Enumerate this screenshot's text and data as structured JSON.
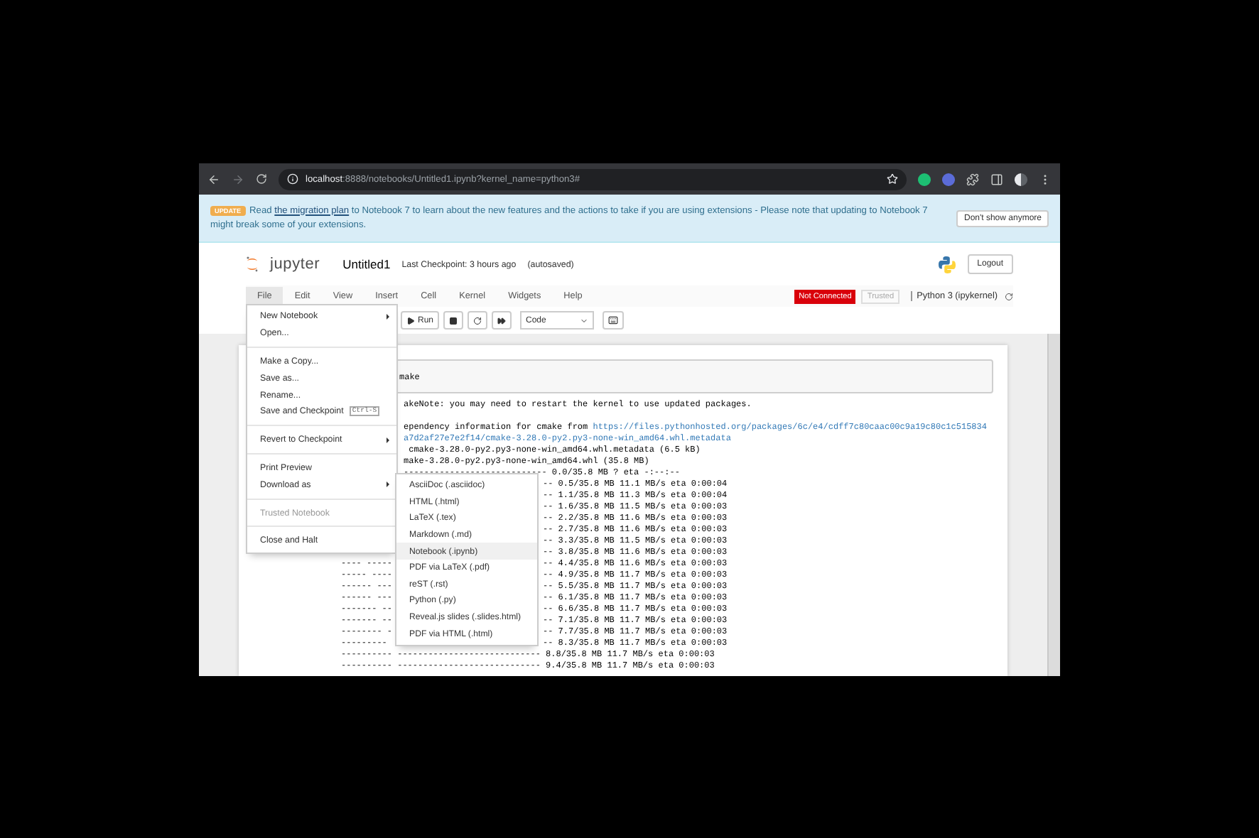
{
  "browser": {
    "url_host": "localhost",
    "url_path": ":8888/notebooks/Untitled1.ipynb?kernel_name=python3#"
  },
  "banner": {
    "badge": "UPDATE",
    "before": "Read ",
    "link": "the migration plan",
    "after": " to Notebook 7 to learn about the new features and the actions to take if you are using extensions - Please note that updating to Notebook 7 might break some of your extensions.",
    "button": "Don't show anymore"
  },
  "header": {
    "logo_text": "jupyter",
    "title": "Untitled1",
    "checkpoint": "Last Checkpoint: 3 hours ago",
    "autosave": "(autosaved)",
    "logout": "Logout"
  },
  "menubar": {
    "items": [
      {
        "label": "File",
        "selected": true
      },
      {
        "label": "Edit",
        "selected": false
      },
      {
        "label": "View",
        "selected": false
      },
      {
        "label": "Insert",
        "selected": false
      },
      {
        "label": "Cell",
        "selected": false
      },
      {
        "label": "Kernel",
        "selected": false
      },
      {
        "label": "Widgets",
        "selected": false
      },
      {
        "label": "Help",
        "selected": false
      }
    ],
    "kernel_status": "Not Connected",
    "trusted": "Trusted",
    "kernel_name": "Python 3 (ipykernel)"
  },
  "toolbar": {
    "run": "Run",
    "cell_type": "Code"
  },
  "cell": {
    "input": "make"
  },
  "output": [
    {
      "kind": "note",
      "middle": "akeNote: you may need to restart the kernel to use updated packages."
    },
    {
      "kind": "log",
      "middle": "ependency information for cmake from ",
      "link": "https://files.pythonhosted.org/packages/6c/e4/cdff7c80caac00c9a19c80c1c515834"
    },
    {
      "kind": "log",
      "link": "a7d2af27e7e2f14/cmake-3.28.0-py2.py3-none-win_amd64.whl.metadata"
    },
    {
      "kind": "log",
      "middle": " cmake-3.28.0-py2.py3-none-win_amd64.whl.metadata (6.5 kB)"
    },
    {
      "kind": "log",
      "middle": "make-3.28.0-py2.py3-none-win_amd64.whl (35.8 MB)"
    },
    {
      "kind": "log",
      "middle": "---------------------------- 0.0/35.8 MB ? eta -:--:--"
    },
    {
      "kind": "log",
      "right": "-- 0.5/35.8 MB 11.1 MB/s eta 0:00:04"
    },
    {
      "kind": "log",
      "right": "-- 1.1/35.8 MB 11.3 MB/s eta 0:00:04"
    },
    {
      "kind": "log",
      "right": "-- 1.6/35.8 MB 11.5 MB/s eta 0:00:03"
    },
    {
      "kind": "log",
      "right": "-- 2.2/35.8 MB 11.6 MB/s eta 0:00:03"
    },
    {
      "kind": "log",
      "right": "-- 2.7/35.8 MB 11.6 MB/s eta 0:00:03"
    },
    {
      "kind": "log",
      "right": "-- 3.3/35.8 MB 11.5 MB/s eta 0:00:03"
    },
    {
      "kind": "log",
      "right": "-- 3.8/35.8 MB 11.6 MB/s eta 0:00:03"
    },
    {
      "kind": "log",
      "left": "---- -----",
      "right": "-- 4.4/35.8 MB 11.6 MB/s eta 0:00:03"
    },
    {
      "kind": "log",
      "left": "----- ----",
      "right": "-- 4.9/35.8 MB 11.7 MB/s eta 0:00:03"
    },
    {
      "kind": "log",
      "left": "------ ---",
      "right": "-- 5.5/35.8 MB 11.7 MB/s eta 0:00:03"
    },
    {
      "kind": "log",
      "left": "------ ---",
      "right": "-- 6.1/35.8 MB 11.7 MB/s eta 0:00:03"
    },
    {
      "kind": "log",
      "left": "------- --",
      "right": "-- 6.6/35.8 MB 11.7 MB/s eta 0:00:03"
    },
    {
      "kind": "log",
      "left": "------- --",
      "right": "-- 7.1/35.8 MB 11.7 MB/s eta 0:00:03"
    },
    {
      "kind": "log",
      "left": "-------- -",
      "right": "-- 7.7/35.8 MB 11.7 MB/s eta 0:00:03"
    },
    {
      "kind": "log",
      "left": "---------",
      "right": "-- 8.3/35.8 MB 11.7 MB/s eta 0:00:03"
    },
    {
      "kind": "log",
      "full": "---------- ---------------------------- 8.8/35.8 MB 11.7 MB/s eta 0:00:03"
    },
    {
      "kind": "log",
      "full": "---------- ---------------------------- 9.4/35.8 MB 11.7 MB/s eta 0:00:03"
    }
  ],
  "file_menu": [
    {
      "kind": "item",
      "label": "New Notebook",
      "submenu": true,
      "disabled": false
    },
    {
      "kind": "item",
      "label": "Open...",
      "submenu": false,
      "disabled": false
    },
    {
      "kind": "divider"
    },
    {
      "kind": "item",
      "label": "Make a Copy...",
      "submenu": false,
      "disabled": false
    },
    {
      "kind": "item",
      "label": "Save as...",
      "submenu": false,
      "disabled": false
    },
    {
      "kind": "item",
      "label": "Rename...",
      "submenu": false,
      "disabled": false
    },
    {
      "kind": "item",
      "label": "Save and Checkpoint",
      "shortcut": "Ctrl-S",
      "submenu": false,
      "disabled": false
    },
    {
      "kind": "divider"
    },
    {
      "kind": "item",
      "label": "Revert to Checkpoint",
      "submenu": true,
      "disabled": false
    },
    {
      "kind": "divider"
    },
    {
      "kind": "item",
      "label": "Print Preview",
      "submenu": false,
      "disabled": false
    },
    {
      "kind": "item",
      "label": "Download as",
      "submenu": true,
      "disabled": false
    },
    {
      "kind": "divider"
    },
    {
      "kind": "item",
      "label": "Trusted Notebook",
      "submenu": false,
      "disabled": true
    },
    {
      "kind": "divider"
    },
    {
      "kind": "item",
      "label": "Close and Halt",
      "submenu": false,
      "disabled": false
    }
  ],
  "download_menu": [
    {
      "label": "AsciiDoc (.asciidoc)",
      "selected": false
    },
    {
      "label": "HTML (.html)",
      "selected": false
    },
    {
      "label": "LaTeX (.tex)",
      "selected": false
    },
    {
      "label": "Markdown (.md)",
      "selected": false
    },
    {
      "label": "Notebook (.ipynb)",
      "selected": true
    },
    {
      "label": "PDF via LaTeX (.pdf)",
      "selected": false
    },
    {
      "label": "reST (.rst)",
      "selected": false
    },
    {
      "label": "Python (.py)",
      "selected": false
    },
    {
      "label": "Reveal.js slides (.slides.html)",
      "selected": false
    },
    {
      "label": "PDF via HTML (.html)",
      "selected": false
    }
  ]
}
